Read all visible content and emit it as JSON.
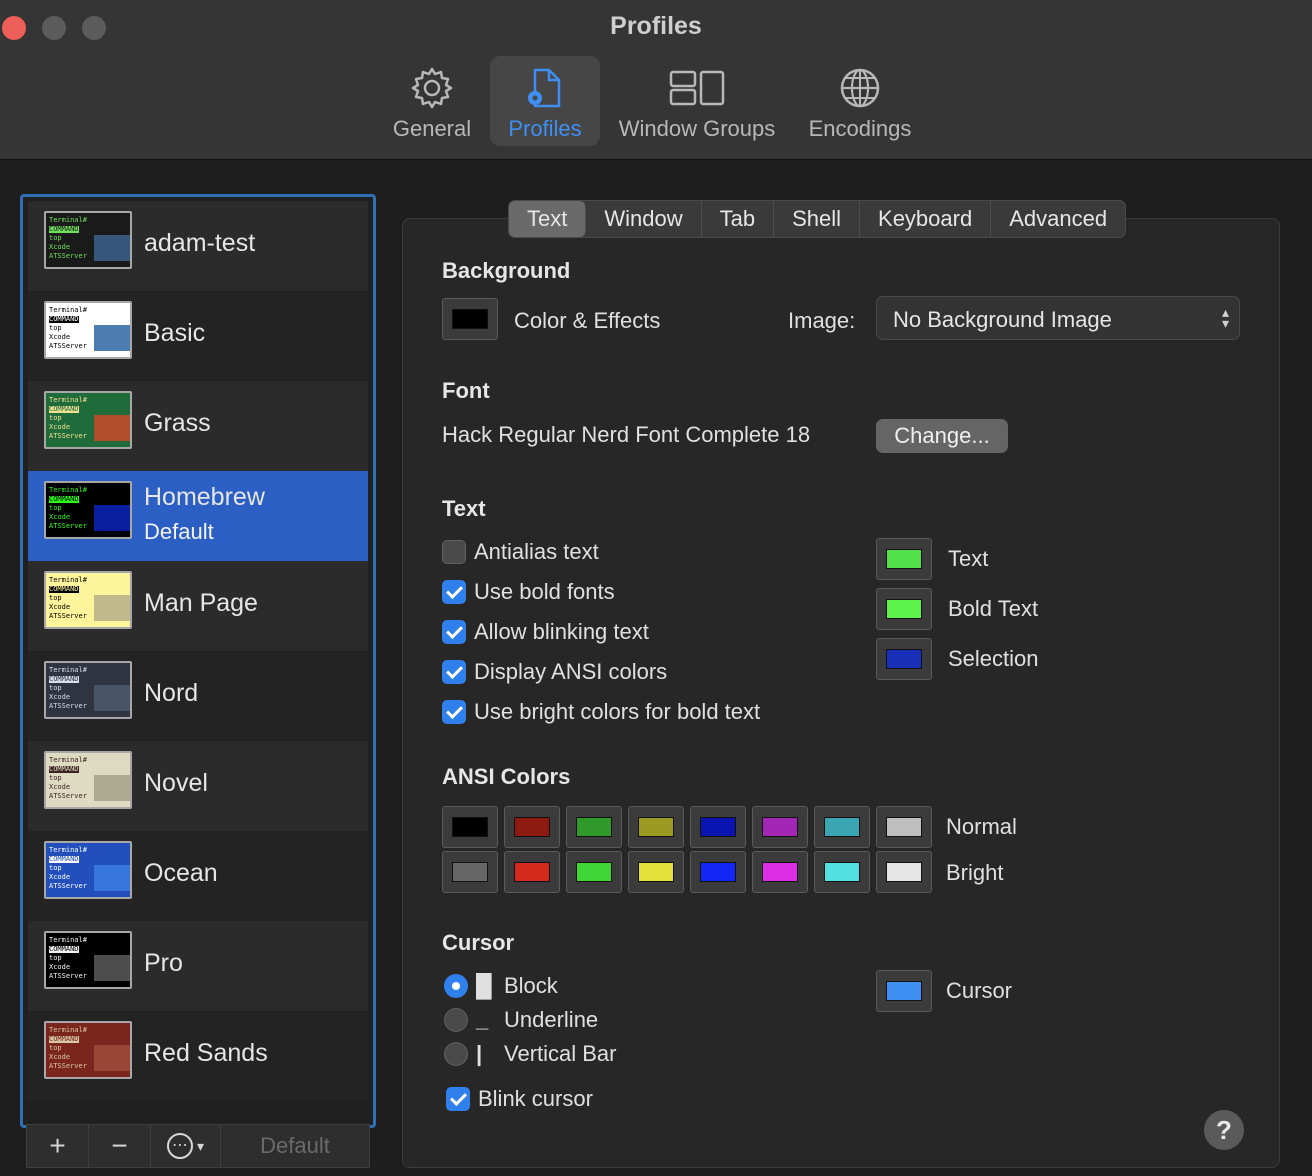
{
  "window": {
    "title": "Profiles"
  },
  "toolbar": {
    "items": [
      {
        "label": "General",
        "icon": "gear-icon",
        "active": false
      },
      {
        "label": "Profiles",
        "icon": "profile-document-icon",
        "active": true
      },
      {
        "label": "Window Groups",
        "icon": "window-groups-icon",
        "active": false
      },
      {
        "label": "Encodings",
        "icon": "globe-icon",
        "active": false
      }
    ]
  },
  "sidebar": {
    "profiles": [
      {
        "name": "adam-test",
        "sub": "",
        "bg": "#1a1a1a",
        "fg": "#6ee05a",
        "accent": "#3a5d8a",
        "selected": false
      },
      {
        "name": "Basic",
        "sub": "",
        "bg": "#ffffff",
        "fg": "#000000",
        "accent": "#3a6ea8",
        "selected": false
      },
      {
        "name": "Grass",
        "sub": "",
        "bg": "#1f6b3a",
        "fg": "#f0e090",
        "accent": "#c24a2a",
        "selected": false
      },
      {
        "name": "Homebrew",
        "sub": "Default",
        "bg": "#000000",
        "fg": "#28fe14",
        "accent": "#0a22b0",
        "selected": true
      },
      {
        "name": "Man Page",
        "sub": "",
        "bg": "#fef49c",
        "fg": "#000000",
        "accent": "#b9b28a",
        "selected": false
      },
      {
        "name": "Nord",
        "sub": "",
        "bg": "#2e3440",
        "fg": "#d8dee9",
        "accent": "#4c566a",
        "selected": false
      },
      {
        "name": "Novel",
        "sub": "",
        "bg": "#dfdbc3",
        "fg": "#3b2322",
        "accent": "#a8a48c",
        "selected": false
      },
      {
        "name": "Ocean",
        "sub": "",
        "bg": "#224fbc",
        "fg": "#ffffff",
        "accent": "#3a7ae0",
        "selected": false
      },
      {
        "name": "Pro",
        "sub": "",
        "bg": "#000000",
        "fg": "#f2f2f2",
        "accent": "#555555",
        "selected": false
      },
      {
        "name": "Red Sands",
        "sub": "",
        "bg": "#7a251e",
        "fg": "#d7c9a7",
        "accent": "#9c4a3a",
        "selected": false
      }
    ],
    "tools": {
      "add": "+",
      "remove": "−",
      "more": "⋯",
      "default": "Default"
    }
  },
  "tabs": [
    "Text",
    "Window",
    "Tab",
    "Shell",
    "Keyboard",
    "Advanced"
  ],
  "active_tab": "Text",
  "background": {
    "heading": "Background",
    "color_effects_label": "Color & Effects",
    "image_label": "Image:",
    "image_value": "No Background Image"
  },
  "font": {
    "heading": "Font",
    "value": "Hack Regular Nerd Font Complete 18",
    "change_label": "Change..."
  },
  "text": {
    "heading": "Text",
    "options": [
      {
        "label": "Antialias text",
        "checked": false
      },
      {
        "label": "Use bold fonts",
        "checked": true
      },
      {
        "label": "Allow blinking text",
        "checked": true
      },
      {
        "label": "Display ANSI colors",
        "checked": true
      },
      {
        "label": "Use bright colors for bold text",
        "checked": true
      }
    ],
    "colors": [
      {
        "label": "Text",
        "color": "#4fe04a"
      },
      {
        "label": "Bold Text",
        "color": "#5cf24a"
      },
      {
        "label": "Selection",
        "color": "#1a2fb8"
      }
    ]
  },
  "ansi": {
    "heading": "ANSI Colors",
    "normal_label": "Normal",
    "bright_label": "Bright",
    "normal": [
      "#000000",
      "#8f1a12",
      "#2f9a2a",
      "#9c9a22",
      "#0a14b0",
      "#a426b4",
      "#3aa6b2",
      "#bfbfbf"
    ],
    "bright": [
      "#666666",
      "#d42a1e",
      "#41d435",
      "#e4e23a",
      "#1226f5",
      "#dd2ee6",
      "#52e0e0",
      "#e6e6e6"
    ]
  },
  "cursor": {
    "heading": "Cursor",
    "options": [
      {
        "label": "Block",
        "glyph": "█",
        "selected": true
      },
      {
        "label": "Underline",
        "glyph": "_",
        "selected": false
      },
      {
        "label": "Vertical Bar",
        "glyph": "|",
        "selected": false
      }
    ],
    "color_label": "Cursor",
    "color": "#3f8ff3",
    "blink_label": "Blink cursor",
    "blink_checked": true
  },
  "help": "?"
}
